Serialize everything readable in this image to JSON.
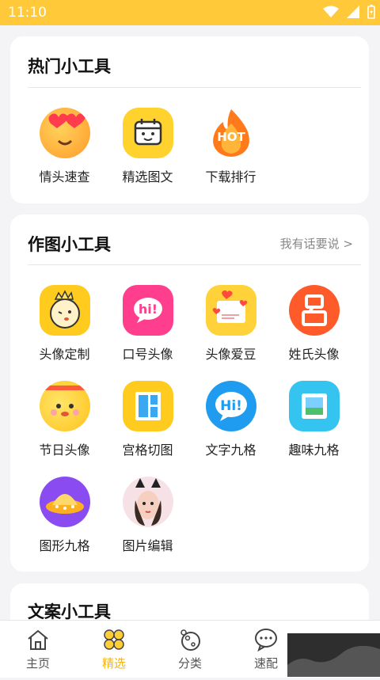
{
  "status": {
    "time": "11:10"
  },
  "sections": {
    "hot": {
      "title": "热门小工具",
      "tools": [
        {
          "label": "情头速查",
          "icon": "heart-eyes-emoji-icon"
        },
        {
          "label": "精选图文",
          "icon": "calendar-smile-icon"
        },
        {
          "label": "下载排行",
          "icon": "hot-flame-icon"
        }
      ]
    },
    "draw": {
      "title": "作图小工具",
      "more": "我有话要说 >",
      "tools": [
        {
          "label": "头像定制",
          "icon": "crown-face-icon"
        },
        {
          "label": "口号头像",
          "icon": "hi-bubble-icon"
        },
        {
          "label": "头像爱豆",
          "icon": "hearts-photo-icon"
        },
        {
          "label": "姓氏头像",
          "icon": "surname-icon",
          "glyph": "吕"
        },
        {
          "label": "节日头像",
          "icon": "headband-face-icon"
        },
        {
          "label": "宫格切图",
          "icon": "grid-cut-icon"
        },
        {
          "label": "文字九格",
          "icon": "hi-text-icon",
          "glyph": "Hi!"
        },
        {
          "label": "趣味九格",
          "icon": "stamp-photo-icon"
        },
        {
          "label": "图形九格",
          "icon": "ufo-icon"
        },
        {
          "label": "图片编辑",
          "icon": "cat-ears-photo-icon"
        }
      ]
    },
    "text": {
      "title": "文案小工具"
    }
  },
  "tabbar": {
    "items": [
      {
        "label": "主页",
        "icon": "home-icon",
        "active": false
      },
      {
        "label": "精选",
        "icon": "clover-icon",
        "active": true
      },
      {
        "label": "分类",
        "icon": "category-icon",
        "active": false
      },
      {
        "label": "速配",
        "icon": "chat-icon",
        "active": false
      }
    ]
  },
  "colors": {
    "accent": "#ffc93a",
    "active_tab": "#f5b600"
  }
}
